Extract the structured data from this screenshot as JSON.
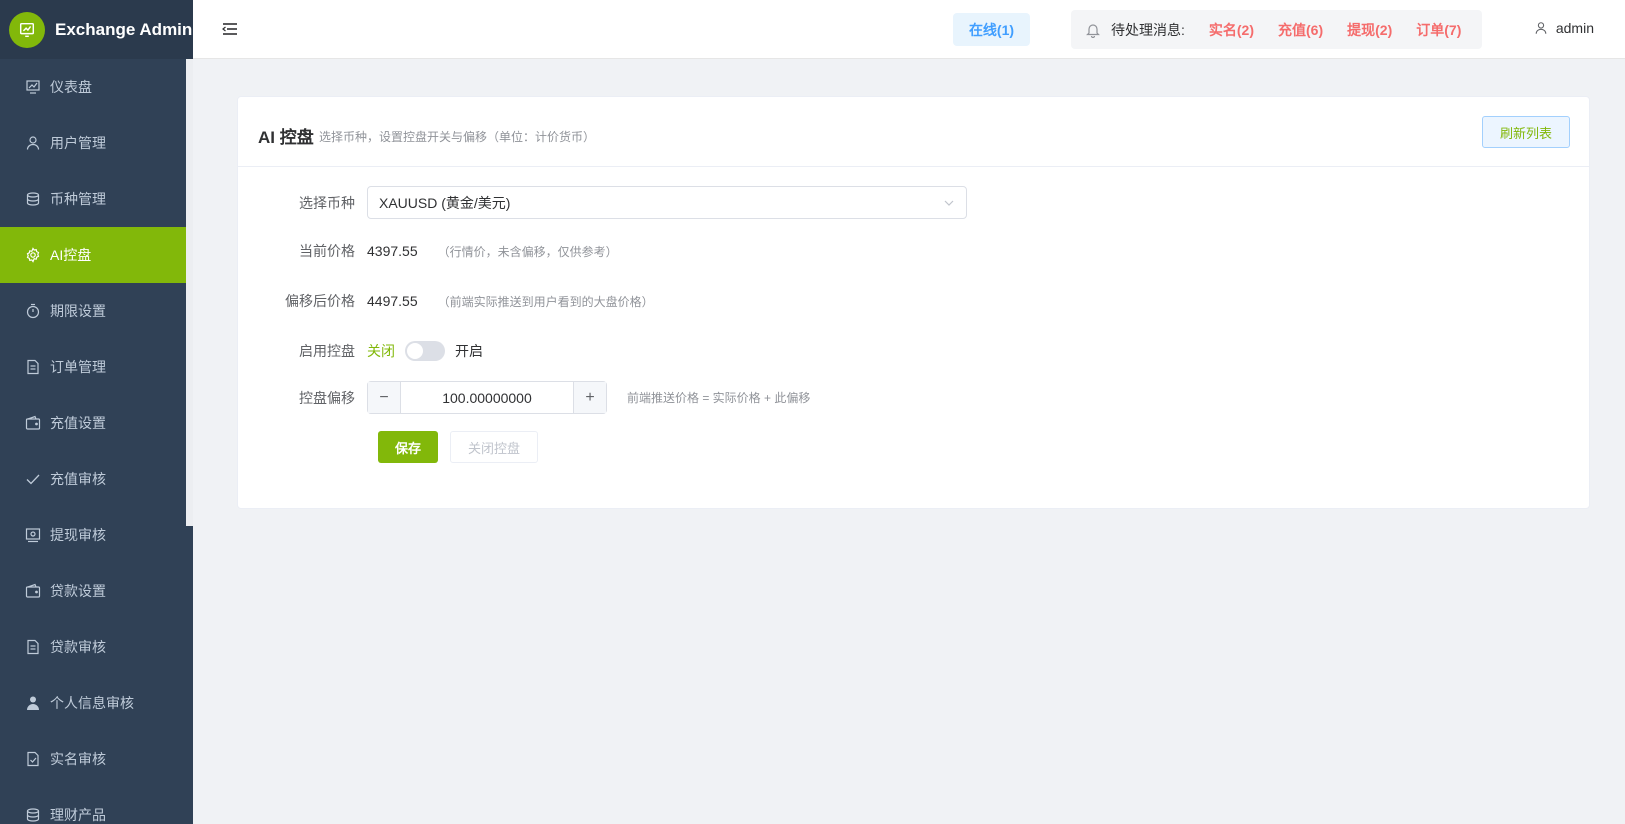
{
  "sidebar": {
    "brand": "Exchange Admin",
    "items": [
      {
        "label": "仪表盘",
        "icon": "chart-icon"
      },
      {
        "label": "用户管理",
        "icon": "user-icon"
      },
      {
        "label": "币种管理",
        "icon": "coins-icon"
      },
      {
        "label": "AI控盘",
        "icon": "gear-icon",
        "active": true
      },
      {
        "label": "期限设置",
        "icon": "timer-icon"
      },
      {
        "label": "订单管理",
        "icon": "document-icon"
      },
      {
        "label": "充值设置",
        "icon": "wallet-icon"
      },
      {
        "label": "充值审核",
        "icon": "check-icon"
      },
      {
        "label": "提现审核",
        "icon": "money-icon"
      },
      {
        "label": "贷款设置",
        "icon": "wallet-icon"
      },
      {
        "label": "贷款审核",
        "icon": "document-icon"
      },
      {
        "label": "个人信息审核",
        "icon": "person-filled-icon"
      },
      {
        "label": "实名审核",
        "icon": "document-check-icon"
      },
      {
        "label": "理财产品",
        "icon": "coins-icon"
      }
    ]
  },
  "header": {
    "online": "在线(1)",
    "pending_label": "待处理消息:",
    "pending": [
      {
        "label": "实名(2)"
      },
      {
        "label": "充值(6)"
      },
      {
        "label": "提现(2)"
      },
      {
        "label": "订单(7)"
      }
    ],
    "user": "admin"
  },
  "card": {
    "title": "AI 控盘",
    "subtitle": "选择币种，设置控盘开关与偏移（单位：计价货币）",
    "refresh": "刷新列表"
  },
  "form": {
    "symbol_label": "选择币种",
    "symbol_value": "XAUUSD (黄金/美元)",
    "price_label": "当前价格",
    "price_value": "4397.55",
    "price_hint": "（行情价，未含偏移，仅供参考）",
    "offset_price_label": "偏移后价格",
    "offset_price_value": "4497.55",
    "offset_price_hint": "（前端实际推送到用户看到的大盘价格）",
    "enable_label": "启用控盘",
    "enable_off": "关闭",
    "enable_on": "开启",
    "enabled": false,
    "offset_label": "控盘偏移",
    "offset_value": "100.00000000",
    "offset_hint": "前端推送价格 = 实际价格 + 此偏移",
    "save": "保存",
    "close": "关闭控盘"
  },
  "colors": {
    "accent": "#82b80a",
    "sidebar_bg": "#304156",
    "danger": "#f56c6c",
    "info": "#409eff"
  }
}
